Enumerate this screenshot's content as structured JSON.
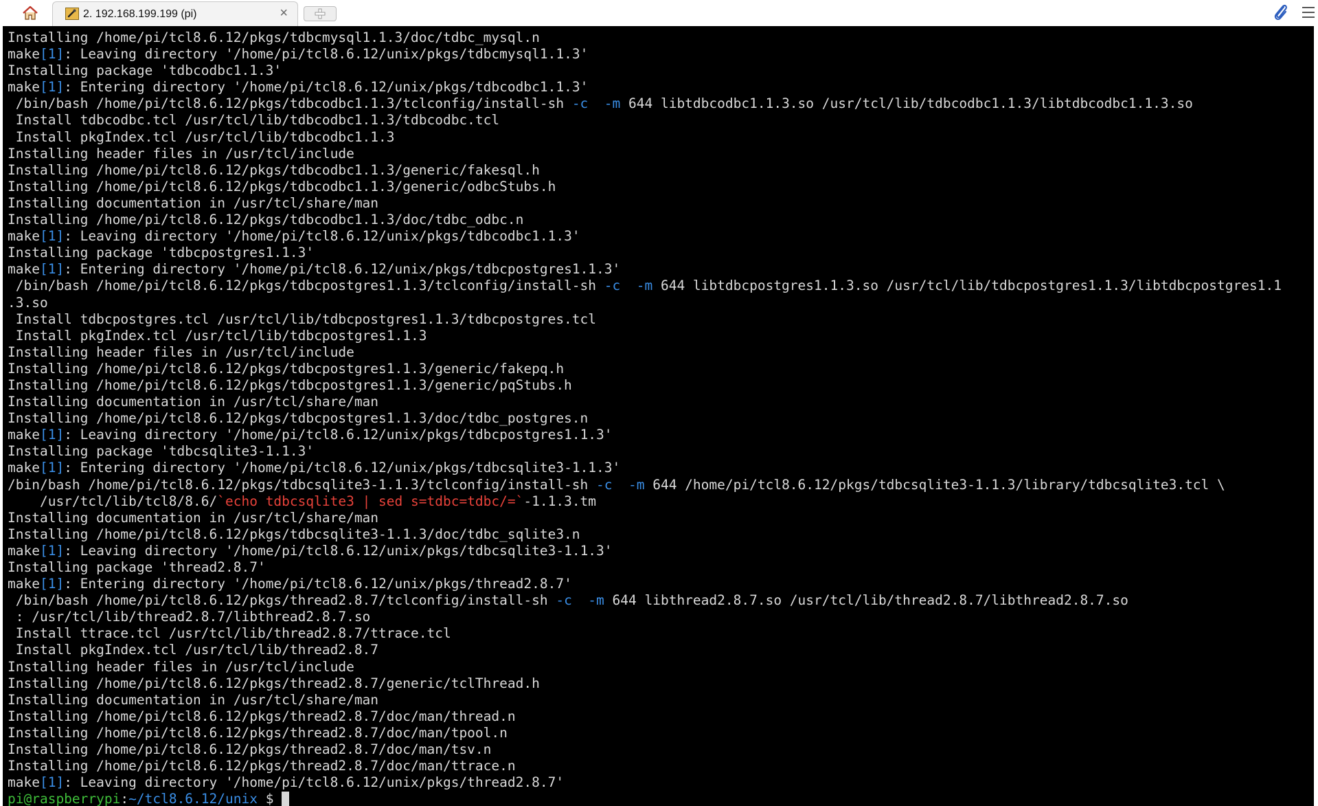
{
  "tabs": {
    "home_icon": "home-icon",
    "active_tab_title": "2. 192.168.199.199 (pi)",
    "close_symbol": "×"
  },
  "colors": {
    "terminal_bg": "#000000",
    "text": "#d9d9d9",
    "blue": "#3a8ee6",
    "red": "#e8423a",
    "green": "#3fbf3a"
  },
  "terminal": {
    "lines": [
      [
        {
          "t": "Installing /home/pi/tcl8.6.12/pkgs/tdbcmysql1.1.3/doc/tdbc_mysql.n"
        }
      ],
      [
        {
          "t": "make"
        },
        {
          "t": "[1]",
          "c": "blue"
        },
        {
          "t": ": Leaving directory '/home/pi/tcl8.6.12/unix/pkgs/tdbcmysql1.1.3'"
        }
      ],
      [
        {
          "t": "Installing package 'tdbcodbc1.1.3'"
        }
      ],
      [
        {
          "t": "make"
        },
        {
          "t": "[1]",
          "c": "blue"
        },
        {
          "t": ": Entering directory '/home/pi/tcl8.6.12/unix/pkgs/tdbcodbc1.1.3'"
        }
      ],
      [
        {
          "t": " /bin/bash /home/pi/tcl8.6.12/pkgs/tdbcodbc1.1.3/tclconfig/install-sh "
        },
        {
          "t": "-c",
          "c": "blue"
        },
        {
          "t": "  "
        },
        {
          "t": "-m",
          "c": "blue"
        },
        {
          "t": " 644 libtdbcodbc1.1.3.so /usr/tcl/lib/tdbcodbc1.1.3/libtdbcodbc1.1.3.so"
        }
      ],
      [
        {
          "t": " Install tdbcodbc.tcl /usr/tcl/lib/tdbcodbc1.1.3/tdbcodbc.tcl"
        }
      ],
      [
        {
          "t": " Install pkgIndex.tcl /usr/tcl/lib/tdbcodbc1.1.3"
        }
      ],
      [
        {
          "t": "Installing header files in /usr/tcl/include"
        }
      ],
      [
        {
          "t": "Installing /home/pi/tcl8.6.12/pkgs/tdbcodbc1.1.3/generic/fakesql.h"
        }
      ],
      [
        {
          "t": "Installing /home/pi/tcl8.6.12/pkgs/tdbcodbc1.1.3/generic/odbcStubs.h"
        }
      ],
      [
        {
          "t": "Installing documentation in /usr/tcl/share/man"
        }
      ],
      [
        {
          "t": "Installing /home/pi/tcl8.6.12/pkgs/tdbcodbc1.1.3/doc/tdbc_odbc.n"
        }
      ],
      [
        {
          "t": "make"
        },
        {
          "t": "[1]",
          "c": "blue"
        },
        {
          "t": ": Leaving directory '/home/pi/tcl8.6.12/unix/pkgs/tdbcodbc1.1.3'"
        }
      ],
      [
        {
          "t": "Installing package 'tdbcpostgres1.1.3'"
        }
      ],
      [
        {
          "t": "make"
        },
        {
          "t": "[1]",
          "c": "blue"
        },
        {
          "t": ": Entering directory '/home/pi/tcl8.6.12/unix/pkgs/tdbcpostgres1.1.3'"
        }
      ],
      [
        {
          "t": " /bin/bash /home/pi/tcl8.6.12/pkgs/tdbcpostgres1.1.3/tclconfig/install-sh "
        },
        {
          "t": "-c",
          "c": "blue"
        },
        {
          "t": "  "
        },
        {
          "t": "-m",
          "c": "blue"
        },
        {
          "t": " 644 libtdbcpostgres1.1.3.so /usr/tcl/lib/tdbcpostgres1.1.3/libtdbcpostgres1.1"
        }
      ],
      [
        {
          "t": ".3.so"
        }
      ],
      [
        {
          "t": " Install tdbcpostgres.tcl /usr/tcl/lib/tdbcpostgres1.1.3/tdbcpostgres.tcl"
        }
      ],
      [
        {
          "t": " Install pkgIndex.tcl /usr/tcl/lib/tdbcpostgres1.1.3"
        }
      ],
      [
        {
          "t": "Installing header files in /usr/tcl/include"
        }
      ],
      [
        {
          "t": "Installing /home/pi/tcl8.6.12/pkgs/tdbcpostgres1.1.3/generic/fakepq.h"
        }
      ],
      [
        {
          "t": "Installing /home/pi/tcl8.6.12/pkgs/tdbcpostgres1.1.3/generic/pqStubs.h"
        }
      ],
      [
        {
          "t": "Installing documentation in /usr/tcl/share/man"
        }
      ],
      [
        {
          "t": "Installing /home/pi/tcl8.6.12/pkgs/tdbcpostgres1.1.3/doc/tdbc_postgres.n"
        }
      ],
      [
        {
          "t": "make"
        },
        {
          "t": "[1]",
          "c": "blue"
        },
        {
          "t": ": Leaving directory '/home/pi/tcl8.6.12/unix/pkgs/tdbcpostgres1.1.3'"
        }
      ],
      [
        {
          "t": "Installing package 'tdbcsqlite3-1.1.3'"
        }
      ],
      [
        {
          "t": "make"
        },
        {
          "t": "[1]",
          "c": "blue"
        },
        {
          "t": ": Entering directory '/home/pi/tcl8.6.12/unix/pkgs/tdbcsqlite3-1.1.3'"
        }
      ],
      [
        {
          "t": "/bin/bash /home/pi/tcl8.6.12/pkgs/tdbcsqlite3-1.1.3/tclconfig/install-sh "
        },
        {
          "t": "-c",
          "c": "blue"
        },
        {
          "t": "  "
        },
        {
          "t": "-m",
          "c": "blue"
        },
        {
          "t": " 644 /home/pi/tcl8.6.12/pkgs/tdbcsqlite3-1.1.3/library/tdbcsqlite3.tcl \\"
        }
      ],
      [
        {
          "t": "    /usr/tcl/lib/tcl8/8.6/"
        },
        {
          "t": "`echo tdbcsqlite3 | sed s=tdbc=tdbc/=`",
          "c": "red"
        },
        {
          "t": "-1.1.3.tm"
        }
      ],
      [
        {
          "t": "Installing documentation in /usr/tcl/share/man"
        }
      ],
      [
        {
          "t": "Installing /home/pi/tcl8.6.12/pkgs/tdbcsqlite3-1.1.3/doc/tdbc_sqlite3.n"
        }
      ],
      [
        {
          "t": "make"
        },
        {
          "t": "[1]",
          "c": "blue"
        },
        {
          "t": ": Leaving directory '/home/pi/tcl8.6.12/unix/pkgs/tdbcsqlite3-1.1.3'"
        }
      ],
      [
        {
          "t": "Installing package 'thread2.8.7'"
        }
      ],
      [
        {
          "t": "make"
        },
        {
          "t": "[1]",
          "c": "blue"
        },
        {
          "t": ": Entering directory '/home/pi/tcl8.6.12/unix/pkgs/thread2.8.7'"
        }
      ],
      [
        {
          "t": " /bin/bash /home/pi/tcl8.6.12/pkgs/thread2.8.7/tclconfig/install-sh "
        },
        {
          "t": "-c",
          "c": "blue"
        },
        {
          "t": "  "
        },
        {
          "t": "-m",
          "c": "blue"
        },
        {
          "t": " 644 libthread2.8.7.so /usr/tcl/lib/thread2.8.7/libthread2.8.7.so"
        }
      ],
      [
        {
          "t": " : /usr/tcl/lib/thread2.8.7/libthread2.8.7.so"
        }
      ],
      [
        {
          "t": " Install ttrace.tcl /usr/tcl/lib/thread2.8.7/ttrace.tcl"
        }
      ],
      [
        {
          "t": " Install pkgIndex.tcl /usr/tcl/lib/thread2.8.7"
        }
      ],
      [
        {
          "t": "Installing header files in /usr/tcl/include"
        }
      ],
      [
        {
          "t": "Installing /home/pi/tcl8.6.12/pkgs/thread2.8.7/generic/tclThread.h"
        }
      ],
      [
        {
          "t": "Installing documentation in /usr/tcl/share/man"
        }
      ],
      [
        {
          "t": "Installing /home/pi/tcl8.6.12/pkgs/thread2.8.7/doc/man/thread.n"
        }
      ],
      [
        {
          "t": "Installing /home/pi/tcl8.6.12/pkgs/thread2.8.7/doc/man/tpool.n"
        }
      ],
      [
        {
          "t": "Installing /home/pi/tcl8.6.12/pkgs/thread2.8.7/doc/man/tsv.n"
        }
      ],
      [
        {
          "t": "Installing /home/pi/tcl8.6.12/pkgs/thread2.8.7/doc/man/ttrace.n"
        }
      ],
      [
        {
          "t": "make"
        },
        {
          "t": "[1]",
          "c": "blue"
        },
        {
          "t": ": Leaving directory '/home/pi/tcl8.6.12/unix/pkgs/thread2.8.7'"
        }
      ]
    ],
    "prompt": {
      "user_host": "pi@raspberrypi",
      "separator": ":",
      "path": "~/tcl8.6.12/unix",
      "symbol": " $ "
    }
  }
}
